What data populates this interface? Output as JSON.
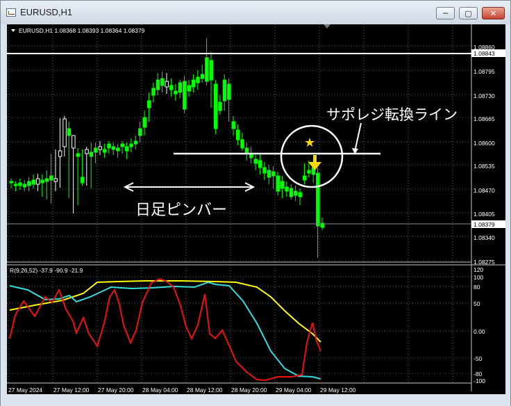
{
  "window": {
    "title": "EURUSD,H1",
    "controls": {
      "minimize": "─",
      "maximize": "▢",
      "close": "✕"
    }
  },
  "chart": {
    "symbol_header": "EURUSD,H1  1.08368 1.08393 1.08364 1.08379",
    "indicator_header": "R(9,26,52) -37.9 -90.9 -21.9",
    "annotations": {
      "resistance_line_label": "サポレジ転換ライン",
      "pinbar_label": "日足ピンバー",
      "star": "★"
    },
    "price_axis": {
      "labels": [
        "1.08860",
        "1.08795",
        "1.08730",
        "1.08665",
        "1.08600",
        "1.08535",
        "1.08470",
        "1.08405",
        "1.08340",
        "1.08275"
      ],
      "marked_price_high": "1.08843",
      "current_price": "1.08379"
    },
    "indicator_axis": {
      "labels": [
        "120",
        "100",
        "80",
        "50",
        "0.00",
        "-50",
        "-80",
        "-100"
      ]
    },
    "time_axis": {
      "labels": [
        "27 May 2024",
        "27 May 12:00",
        "27 May 20:00",
        "28 May 04:00",
        "28 May 12:00",
        "28 May 20:00",
        "29 May 04:00",
        "29 May 12:00"
      ]
    },
    "colors": {
      "background": "#000000",
      "bull_candle": "#ffffff",
      "bear_candle": "#00ff00",
      "yellow_line": "#ffff00",
      "cyan_line": "#33dddd",
      "red_line": "#ee1111",
      "grid": "#5a5a5a",
      "arrow": "#ffd700"
    }
  }
}
